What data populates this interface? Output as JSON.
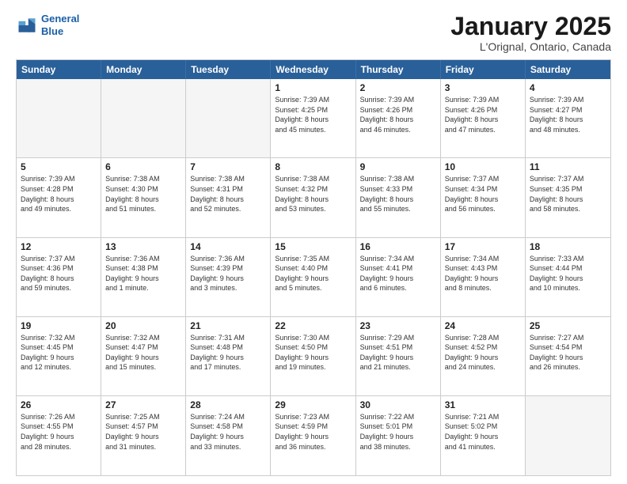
{
  "logo": {
    "line1": "General",
    "line2": "Blue"
  },
  "title": "January 2025",
  "subtitle": "L'Orignal, Ontario, Canada",
  "days": [
    "Sunday",
    "Monday",
    "Tuesday",
    "Wednesday",
    "Thursday",
    "Friday",
    "Saturday"
  ],
  "weeks": [
    [
      {
        "day": "",
        "empty": true,
        "detail": ""
      },
      {
        "day": "",
        "empty": true,
        "detail": ""
      },
      {
        "day": "",
        "empty": true,
        "detail": ""
      },
      {
        "day": "1",
        "detail": "Sunrise: 7:39 AM\nSunset: 4:25 PM\nDaylight: 8 hours\nand 45 minutes."
      },
      {
        "day": "2",
        "detail": "Sunrise: 7:39 AM\nSunset: 4:26 PM\nDaylight: 8 hours\nand 46 minutes."
      },
      {
        "day": "3",
        "detail": "Sunrise: 7:39 AM\nSunset: 4:26 PM\nDaylight: 8 hours\nand 47 minutes."
      },
      {
        "day": "4",
        "detail": "Sunrise: 7:39 AM\nSunset: 4:27 PM\nDaylight: 8 hours\nand 48 minutes."
      }
    ],
    [
      {
        "day": "5",
        "detail": "Sunrise: 7:39 AM\nSunset: 4:28 PM\nDaylight: 8 hours\nand 49 minutes."
      },
      {
        "day": "6",
        "detail": "Sunrise: 7:38 AM\nSunset: 4:30 PM\nDaylight: 8 hours\nand 51 minutes."
      },
      {
        "day": "7",
        "detail": "Sunrise: 7:38 AM\nSunset: 4:31 PM\nDaylight: 8 hours\nand 52 minutes."
      },
      {
        "day": "8",
        "detail": "Sunrise: 7:38 AM\nSunset: 4:32 PM\nDaylight: 8 hours\nand 53 minutes."
      },
      {
        "day": "9",
        "detail": "Sunrise: 7:38 AM\nSunset: 4:33 PM\nDaylight: 8 hours\nand 55 minutes."
      },
      {
        "day": "10",
        "detail": "Sunrise: 7:37 AM\nSunset: 4:34 PM\nDaylight: 8 hours\nand 56 minutes."
      },
      {
        "day": "11",
        "detail": "Sunrise: 7:37 AM\nSunset: 4:35 PM\nDaylight: 8 hours\nand 58 minutes."
      }
    ],
    [
      {
        "day": "12",
        "detail": "Sunrise: 7:37 AM\nSunset: 4:36 PM\nDaylight: 8 hours\nand 59 minutes."
      },
      {
        "day": "13",
        "detail": "Sunrise: 7:36 AM\nSunset: 4:38 PM\nDaylight: 9 hours\nand 1 minute."
      },
      {
        "day": "14",
        "detail": "Sunrise: 7:36 AM\nSunset: 4:39 PM\nDaylight: 9 hours\nand 3 minutes."
      },
      {
        "day": "15",
        "detail": "Sunrise: 7:35 AM\nSunset: 4:40 PM\nDaylight: 9 hours\nand 5 minutes."
      },
      {
        "day": "16",
        "detail": "Sunrise: 7:34 AM\nSunset: 4:41 PM\nDaylight: 9 hours\nand 6 minutes."
      },
      {
        "day": "17",
        "detail": "Sunrise: 7:34 AM\nSunset: 4:43 PM\nDaylight: 9 hours\nand 8 minutes."
      },
      {
        "day": "18",
        "detail": "Sunrise: 7:33 AM\nSunset: 4:44 PM\nDaylight: 9 hours\nand 10 minutes."
      }
    ],
    [
      {
        "day": "19",
        "detail": "Sunrise: 7:32 AM\nSunset: 4:45 PM\nDaylight: 9 hours\nand 12 minutes."
      },
      {
        "day": "20",
        "detail": "Sunrise: 7:32 AM\nSunset: 4:47 PM\nDaylight: 9 hours\nand 15 minutes."
      },
      {
        "day": "21",
        "detail": "Sunrise: 7:31 AM\nSunset: 4:48 PM\nDaylight: 9 hours\nand 17 minutes."
      },
      {
        "day": "22",
        "detail": "Sunrise: 7:30 AM\nSunset: 4:50 PM\nDaylight: 9 hours\nand 19 minutes."
      },
      {
        "day": "23",
        "detail": "Sunrise: 7:29 AM\nSunset: 4:51 PM\nDaylight: 9 hours\nand 21 minutes."
      },
      {
        "day": "24",
        "detail": "Sunrise: 7:28 AM\nSunset: 4:52 PM\nDaylight: 9 hours\nand 24 minutes."
      },
      {
        "day": "25",
        "detail": "Sunrise: 7:27 AM\nSunset: 4:54 PM\nDaylight: 9 hours\nand 26 minutes."
      }
    ],
    [
      {
        "day": "26",
        "detail": "Sunrise: 7:26 AM\nSunset: 4:55 PM\nDaylight: 9 hours\nand 28 minutes."
      },
      {
        "day": "27",
        "detail": "Sunrise: 7:25 AM\nSunset: 4:57 PM\nDaylight: 9 hours\nand 31 minutes."
      },
      {
        "day": "28",
        "detail": "Sunrise: 7:24 AM\nSunset: 4:58 PM\nDaylight: 9 hours\nand 33 minutes."
      },
      {
        "day": "29",
        "detail": "Sunrise: 7:23 AM\nSunset: 4:59 PM\nDaylight: 9 hours\nand 36 minutes."
      },
      {
        "day": "30",
        "detail": "Sunrise: 7:22 AM\nSunset: 5:01 PM\nDaylight: 9 hours\nand 38 minutes."
      },
      {
        "day": "31",
        "detail": "Sunrise: 7:21 AM\nSunset: 5:02 PM\nDaylight: 9 hours\nand 41 minutes."
      },
      {
        "day": "",
        "empty": true,
        "detail": ""
      }
    ]
  ]
}
